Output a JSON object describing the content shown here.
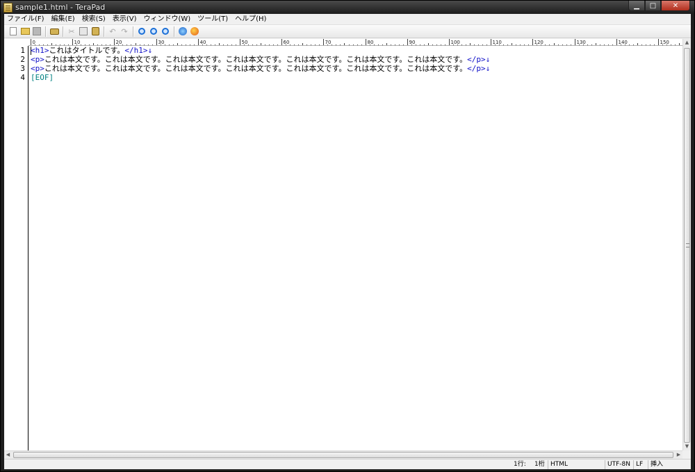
{
  "window": {
    "title": "sample1.html - TeraPad",
    "buttons": {
      "minimize": "▁",
      "maximize": "□",
      "close": "✕"
    }
  },
  "menubar": {
    "items": [
      "ファイル(F)",
      "編集(E)",
      "検索(S)",
      "表示(V)",
      "ウィンドウ(W)",
      "ツール(T)",
      "ヘルプ(H)"
    ]
  },
  "toolbar": {
    "icons": [
      "new-file-icon",
      "open-folder-icon",
      "save-icon",
      "print-icon",
      "cut-icon",
      "copy-icon",
      "paste-icon",
      "undo-icon",
      "redo-icon",
      "find-icon",
      "find-next-icon",
      "find-prev-icon",
      "ie-browser-icon",
      "firefox-browser-icon"
    ],
    "undo_glyph": "↶",
    "redo_glyph": "↷",
    "cut_glyph": "✂"
  },
  "ruler": {
    "labels": [
      "0",
      "10",
      "20",
      "30",
      "40",
      "50",
      "60",
      "70",
      "80",
      "90",
      "100",
      "110",
      "120",
      "130",
      "140",
      "150"
    ]
  },
  "editor": {
    "line_numbers": [
      "1",
      "2",
      "3",
      "4"
    ],
    "lines": [
      {
        "open_tag": "<h1>",
        "text": "これはタイトルです。",
        "close_tag": "</h1>",
        "newline": "↓"
      },
      {
        "open_tag": "<p>",
        "text": "これは本文です。これは本文です。これは本文です。これは本文です。これは本文です。これは本文です。これは本文です。",
        "close_tag": "</p>",
        "newline": "↓"
      },
      {
        "open_tag": "<p>",
        "text": "これは本文です。これは本文です。これは本文です。これは本文です。これは本文です。これは本文です。これは本文です。",
        "close_tag": "</p>",
        "newline": "↓"
      }
    ],
    "eof": "[EOF]"
  },
  "statusbar": {
    "line": "1行:",
    "column": "1桁",
    "mode": "HTML",
    "encoding": "UTF-8N",
    "linebreak": "LF",
    "insert_mode": "挿入"
  },
  "colors": {
    "tag": "#1010c8",
    "eof": "#008080",
    "gutter_border": "#000000"
  }
}
